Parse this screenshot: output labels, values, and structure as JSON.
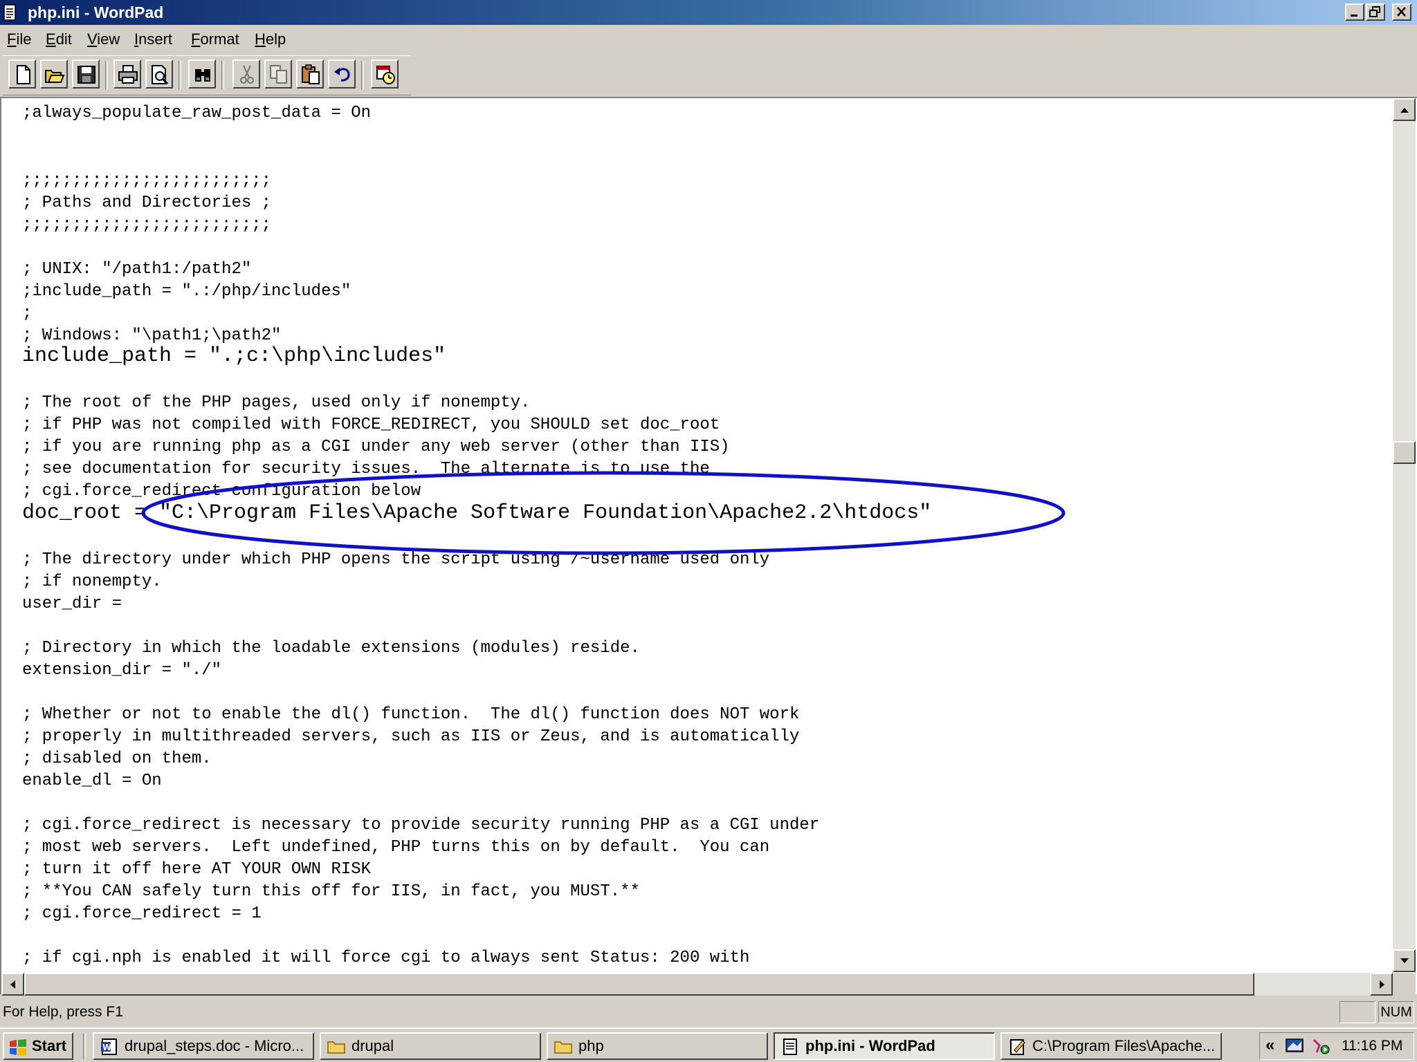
{
  "window": {
    "title": "php.ini - WordPad"
  },
  "menu": [
    {
      "name": "menu-file",
      "label": "File"
    },
    {
      "name": "menu-edit",
      "label": "Edit"
    },
    {
      "name": "menu-view",
      "label": "View"
    },
    {
      "name": "menu-insert",
      "label": "Insert"
    },
    {
      "name": "menu-format",
      "label": "Format"
    },
    {
      "name": "menu-help",
      "label": "Help"
    }
  ],
  "toolbar": {
    "icons": [
      "new-document-icon",
      "open-folder-icon",
      "save-icon",
      "print-icon",
      "print-preview-icon",
      "find-icon",
      "cut-icon",
      "copy-icon",
      "paste-icon",
      "undo-icon",
      "insert-date-time-icon"
    ]
  },
  "document": {
    "lines": [
      {
        "text": ";always_populate_raw_post_data = On"
      },
      {
        "text": ";;;;;;;;;;;;;;;;;;;;;;;;;"
      },
      {
        "text": "; Paths and Directories ;"
      },
      {
        "text": ";;;;;;;;;;;;;;;;;;;;;;;;;"
      },
      {
        "text": "; UNIX: \"/path1:/path2\""
      },
      {
        "text": ";include_path = \".:/php/includes\""
      },
      {
        "text": ";"
      },
      {
        "text": "; Windows: \"\\path1;\\path2\""
      },
      {
        "text": "include_path = \".;c:\\php\\includes\"",
        "emphasis": true
      },
      {
        "text": "; The root of the PHP pages, used only if nonempty."
      },
      {
        "text": "; if PHP was not compiled with FORCE_REDIRECT, you SHOULD set doc_root"
      },
      {
        "text": "; if you are running php as a CGI under any web server (other than IIS)"
      },
      {
        "text": "; see documentation for security issues.  The alternate is to use the"
      },
      {
        "text": "; cgi.force_redirect configuration below"
      },
      {
        "text": "doc_root = \"C:\\Program Files\\Apache Software Foundation\\Apache2.2\\htdocs\"",
        "emphasis": true,
        "highlighted": true
      },
      {
        "text": "; The directory under which PHP opens the script using /~username used only"
      },
      {
        "text": "; if nonempty."
      },
      {
        "text": "user_dir ="
      },
      {
        "text": "; Directory in which the loadable extensions (modules) reside."
      },
      {
        "text": "extension_dir = \"./\""
      },
      {
        "text": "; Whether or not to enable the dl() function.  The dl() function does NOT work"
      },
      {
        "text": "; properly in multithreaded servers, such as IIS or Zeus, and is automatically"
      },
      {
        "text": "; disabled on them."
      },
      {
        "text": "enable_dl = On"
      },
      {
        "text": "; cgi.force_redirect is necessary to provide security running PHP as a CGI under"
      },
      {
        "text": "; most web servers.  Left undefined, PHP turns this on by default.  You can"
      },
      {
        "text": "; turn it off here AT YOUR OWN RISK"
      },
      {
        "text": "; **You CAN safely turn this off for IIS, in fact, you MUST.**"
      },
      {
        "text": "; cgi.force_redirect = 1"
      },
      {
        "text": "; if cgi.nph is enabled it will force cgi to always sent Status: 200 with"
      }
    ],
    "annotation_color": "#1010c8"
  },
  "status": {
    "help_text": "For Help, press F1",
    "num": "NUM"
  },
  "taskbar": {
    "start_label": "Start",
    "tasks": [
      {
        "name": "task-drupal-steps",
        "label": "drupal_steps.doc - Micro...",
        "icon": "word-document-icon",
        "active": false
      },
      {
        "name": "task-drupal-folder",
        "label": "drupal",
        "icon": "folder-icon",
        "active": false
      },
      {
        "name": "task-php-folder",
        "label": "php",
        "icon": "folder-icon",
        "active": false
      },
      {
        "name": "task-wordpad",
        "label": "php.ini - WordPad",
        "icon": "wordpad-icon",
        "active": true
      },
      {
        "name": "task-apache-notepad",
        "label": "C:\\Program Files\\Apache...",
        "icon": "notepad-icon",
        "active": false
      }
    ],
    "clock": "11:16 PM"
  }
}
